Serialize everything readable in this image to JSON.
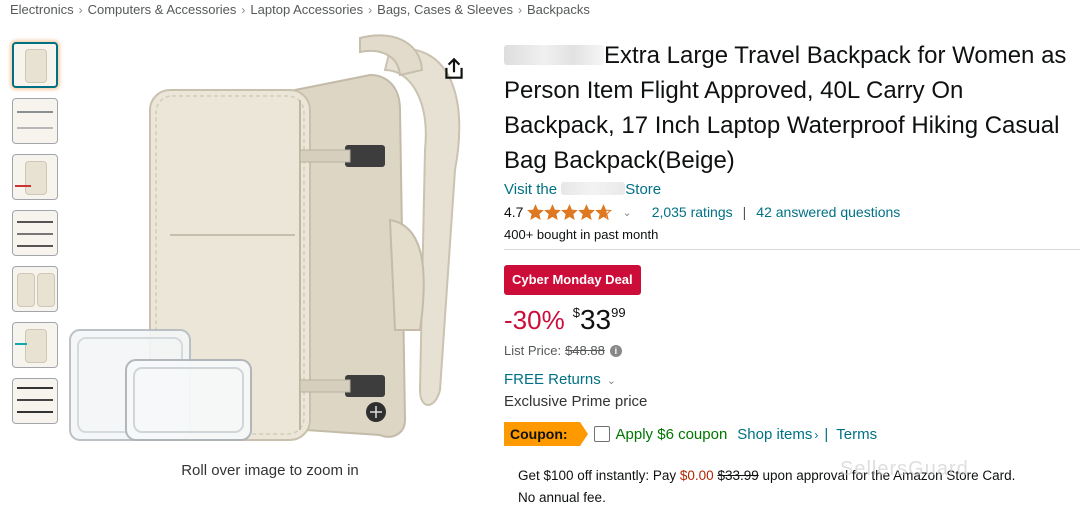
{
  "breadcrumb": [
    "Electronics",
    "Computers & Accessories",
    "Laptop Accessories",
    "Bags, Cases & Sleeves",
    "Backpacks"
  ],
  "breadcrumb_separator": "›",
  "thumbnails_count": 7,
  "zoom_hint": "Roll over image to zoom in",
  "product": {
    "title": "Extra Large Travel Backpack for Women as Person Item Flight Approved, 40L Carry On Backpack, 17 Inch Laptop Waterproof Hiking Casual Bag Backpack(Beige)",
    "store_prefix": "Visit the",
    "store_suffix": "Store",
    "rating": "4.7",
    "rating_value": 4.7,
    "ratings_count": "2,035 ratings",
    "answered_questions": "42 answered questions",
    "bought": "400+ bought in past month"
  },
  "price": {
    "deal_badge": "Cyber Monday Deal",
    "discount": "-30%",
    "currency": "$",
    "whole": "33",
    "fraction": "99",
    "list_label": "List Price:",
    "list_value": "$48.88",
    "free_returns": "FREE Returns",
    "prime_price": "Exclusive Prime price"
  },
  "coupon": {
    "badge": "Coupon:",
    "text": "Apply $6 coupon",
    "shop_items": "Shop items",
    "shop_items_arrow": "›",
    "separator": "|",
    "terms": "Terms"
  },
  "offer": {
    "pre": "Get $100 off instantly: Pay",
    "pay": "$0.00",
    "was": "$33.99",
    "post": "upon approval for the Amazon Store Card.",
    "line2": "No annual fee."
  },
  "watermark": "SellersGuard",
  "colors": {
    "link": "#007185",
    "deal": "#cc0c39",
    "star": "#de7921",
    "coupon_bg": "#ff9900",
    "coupon_text": "#007600",
    "offer_red": "#b12704"
  }
}
